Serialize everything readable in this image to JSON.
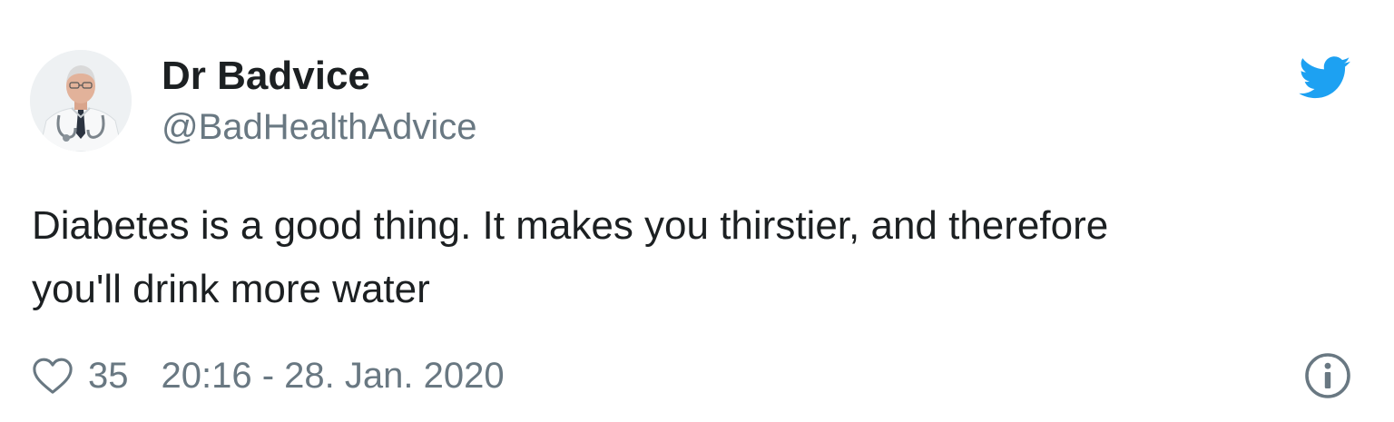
{
  "tweet": {
    "author_name": "Dr Badvice",
    "author_handle": "@BadHealthAdvice",
    "text": "Diabetes is a good thing. It makes you thirstier, and therefore\nyou'll drink more water",
    "likes": "35",
    "timestamp": "20:16 - 28. Jan. 2020"
  },
  "icons": {
    "platform": "twitter-bird-icon",
    "like": "heart-icon",
    "info": "info-icon"
  },
  "colors": {
    "brand": "#1da1f2",
    "text": "#1c2022",
    "muted": "#697882"
  }
}
